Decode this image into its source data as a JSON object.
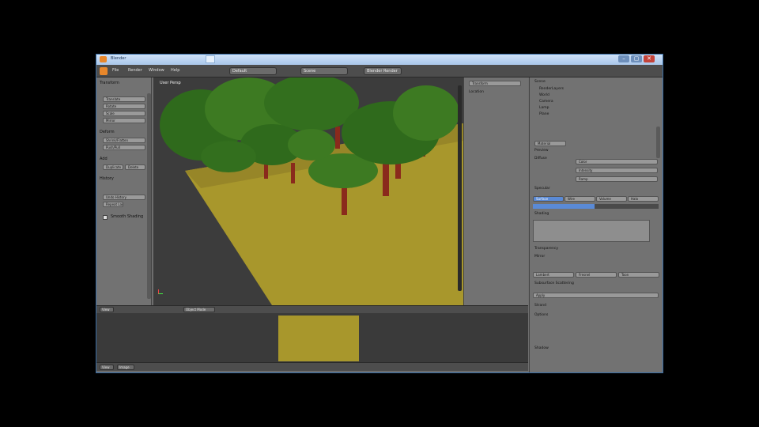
{
  "window": {
    "title": "Blender"
  },
  "header": {
    "menu": [
      "File",
      "Render",
      "Window",
      "Help"
    ],
    "screen_layout": "Default",
    "scene": "Scene",
    "render_engine": "Blender Render"
  },
  "toolshelf": {
    "panels": [
      {
        "title": "Transform",
        "buttons": [
          "Translate",
          "Rotate",
          "Scale",
          "Mirror"
        ]
      },
      {
        "title": "Deform",
        "buttons": [
          "Shrink/Flatten",
          "Push/Pull"
        ]
      },
      {
        "title": "Add",
        "buttons": [
          "Duplicate",
          "Delete"
        ]
      },
      {
        "title": "History",
        "buttons": [
          "Undo History",
          "Repeat Last"
        ]
      }
    ],
    "checkbox_label": "Smooth Shading"
  },
  "viewport": {
    "label": "User Persp"
  },
  "npanel": {
    "title": "Transform",
    "line1": "Location"
  },
  "outliner": {
    "items": [
      "Scene",
      "RenderLayers",
      "World",
      "Camera",
      "Lamp",
      "Plane"
    ]
  },
  "properties": {
    "name": "Material",
    "sections": [
      "Preview",
      "Diffuse",
      "Specular",
      "Shading",
      "Transparency",
      "Mirror",
      "Subsurface Scattering",
      "Strand",
      "Options",
      "Shadow"
    ],
    "color_field": "Color",
    "intensity_field": "Intensity",
    "ramp_label": "Ramp",
    "tabs": [
      "Surface",
      "Wire",
      "Volume",
      "Halo"
    ],
    "buttons": [
      "Lambert",
      "Fresnel",
      "Toon"
    ],
    "apply_button": "Apply"
  },
  "uv_header": {
    "view": "View",
    "image": "Image",
    "mode": "Object Mode"
  },
  "colors": {
    "accent_blue": "#5a8ad6",
    "grass": "#a8972c",
    "tree_trunk": "#8a2a1c",
    "foliage": "#3d7a22"
  }
}
